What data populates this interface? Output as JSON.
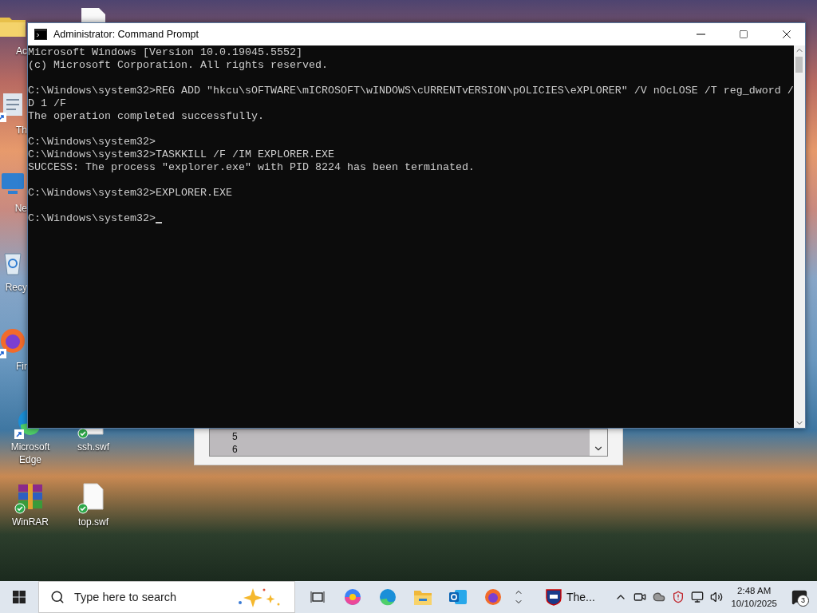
{
  "desktop_icons": [
    {
      "label": "Ac",
      "kind": "folder"
    },
    {
      "label": "Th",
      "kind": "shortcut",
      "shortcut": true
    },
    {
      "label": "Ne",
      "kind": "network"
    },
    {
      "label": "Recy",
      "kind": "recycle"
    },
    {
      "label": "Fir",
      "kind": "firefox",
      "shortcut": true
    },
    {
      "label": "Microsoft Edge",
      "kind": "edge",
      "shortcut": true
    },
    {
      "label": "WinRAR",
      "kind": "winrar",
      "synced": true
    },
    {
      "label": "ssh.swf",
      "kind": "file",
      "synced": true
    },
    {
      "label": "top.swf",
      "kind": "file",
      "synced": true
    }
  ],
  "background_window": {
    "list_items": [
      "5",
      "6"
    ]
  },
  "console_window": {
    "title": "Administrator: Command Prompt",
    "blocks": [
      [
        "Microsoft Windows [Version 10.0.19045.5552]",
        "(c) Microsoft Corporation. All rights reserved."
      ],
      [
        "C:\\Windows\\system32>REG ADD \"hkcu\\sOFTWARE\\mICROSOFT\\wINDOWS\\cURRENTvERSION\\pOLICIES\\eXPLORER\" /V nOcLOSE /T reg_dword /",
        "D 1 /F",
        "The operation completed successfully."
      ],
      [
        "C:\\Windows\\system32>",
        "C:\\Windows\\system32>TASKKILL /F /IM EXPLORER.EXE",
        "SUCCESS: The process \"explorer.exe\" with PID 8224 has been terminated."
      ],
      [
        "C:\\Windows\\system32>EXPLORER.EXE"
      ],
      [
        "C:\\Windows\\system32>"
      ]
    ]
  },
  "taskbar": {
    "search": {
      "placeholder": "Type here to search"
    },
    "running_app": {
      "label": "The..."
    },
    "clock": {
      "time": "2:48 AM",
      "date": "10/10/2025"
    },
    "notifications": {
      "count": "3"
    }
  }
}
